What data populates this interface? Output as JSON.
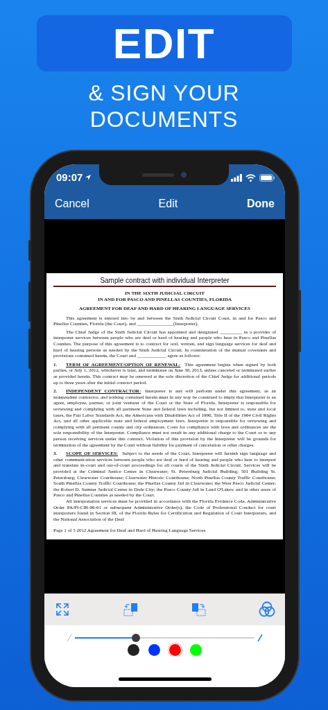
{
  "banner": {
    "title": "EDIT",
    "subtitle_lines": [
      "& SIGN YOUR",
      "DOCUMENTS"
    ]
  },
  "status_bar": {
    "time": "09:07"
  },
  "nav": {
    "left": "Cancel",
    "title": "Edit",
    "right": "Done"
  },
  "document": {
    "blocks": [
      {
        "kind": "title",
        "text": "Sample contract with individual Interpreter"
      },
      {
        "kind": "heading",
        "text": "IN THE SIXTH JUDICIAL CIRCUIT"
      },
      {
        "kind": "heading",
        "text": "IN AND FOR PASCO AND PINELLAS COUNTIES, FLORIDA"
      },
      {
        "kind": "subheading",
        "text": "AGREEMENT FOR DEAF AND HARD OF HEARING LANGUAGE SERVICES"
      },
      {
        "kind": "paragraph",
        "text": "This agreement is entered into by and between the Sixth Judicial Circuit Court, in and for Pasco and Pinellas Counties, Florida (the Court), and _______________(Interpreter)."
      },
      {
        "kind": "paragraph",
        "text": "The Chief Judge of the Sixth Judicial Circuit has appointed and designated _________ as a provider of interpreter services between people who are deaf or hard of hearing and people who hear in Pasco and Pinellas Counties. The purpose of this agreement is to contract for oral, written, and sign language services for deaf and hard of hearing persons as needed by the Sixth Judicial Circuit. In consideration of the mutual covenants and provisions contained herein, the Court and ____________ agree as follows:"
      },
      {
        "kind": "section",
        "number": "1.",
        "heading": "TERM OF AGREEMENT/OPTION OF RENEWAL:",
        "text": "This agreement begins when signed by both parties, or July 1, 2012, whichever is later, and terminates on June 30, 2013, unless canceled or terminated earlier as provided herein. This contract may be renewed at the sole discretion of the Chief Judge for additional periods up to three years after the initial contract period."
      },
      {
        "kind": "section",
        "number": "2.",
        "heading": "INDEPENDENT CONTRACTOR:",
        "text": "Interpreter is and will perform under this agreement, as an independent contractor, and nothing contained herein must in any way be construed to imply that Interpreter is an agent, employee, partner, or joint venturer of the Court or the State of Florida. Interpreter is responsible for reviewing and complying with all pertinent State and federal laws including, but not limited to, state and local taxes, the Fair Labor Standards Act, the Americans with Disabilities Act of 1990, Title II of the 1964 Civil Rights Act, and all other applicable state and federal employment laws. Interpreter is responsible for reviewing and complying with all pertinent county and city ordinances. Costs for compliance with laws and ordinances are the sole responsibility of the Interpreter. Compliance must not result in any additional charge to the Court or to any person receiving services under this contract. Violation of this provision by the Interpreter will be grounds for termination of the agreement by the Court without liability for payment of cancelation or other charges."
      },
      {
        "kind": "section",
        "number": "3.",
        "heading": "SCOPE OF SERVICES:",
        "text": "Subject to the needs of the Court, Interpreter will furnish sign language and other communication services between people who are deaf or hard of hearing and people who hear to interpret and translate in-court and out-of-court proceedings for all courts of the Sixth Judicial Circuit. Services will be provided at the Criminal Justice Center in Clearwater; St. Petersburg Judicial Building; 501 Building St. Petersburg; Clearwater Courthouse; Clearwater Historic Courthouse; North Pinellas County Traffic Courthouse; South Pinellas County Traffic Courthouse; the Pinellas County Jail in Clearwater; the West Pasco Judicial Center; the Robert D. Sumner Judicial Center in Dade City; the Pasco County Jail in Land O'Lakes; and in other areas of Pasco and Pinellas Counties as needed by the Court."
      },
      {
        "kind": "paragraph_tight",
        "text": "All interpretation services must be provided in accordance with the Florida Evidence Code, Administrative Order PA/PI-CIR-96-61 or subsequent Administrative Order(s), the Code of Professional Conduct for court interpreters found in Section III, of the Florida Rules for Certification and Regulation of Court Interpreters, and the National Association of the Deaf"
      },
      {
        "kind": "footer",
        "text": "Page 1 of 5 2012 Agreement for Deaf and Hard of Hearing Language Services"
      }
    ]
  },
  "toolbar": [
    {
      "kind": "expand"
    },
    {
      "kind": "rotate_left"
    },
    {
      "kind": "rotate_right"
    },
    {
      "kind": "filters"
    }
  ],
  "pen_slider": {
    "level": 0.34
  },
  "colors": [
    {
      "color": "#222222",
      "selected": false
    },
    {
      "color": "#0033ff",
      "selected": false
    },
    {
      "color": "#ff0000",
      "selected": true
    },
    {
      "color": "#00ff00",
      "selected": false
    }
  ]
}
